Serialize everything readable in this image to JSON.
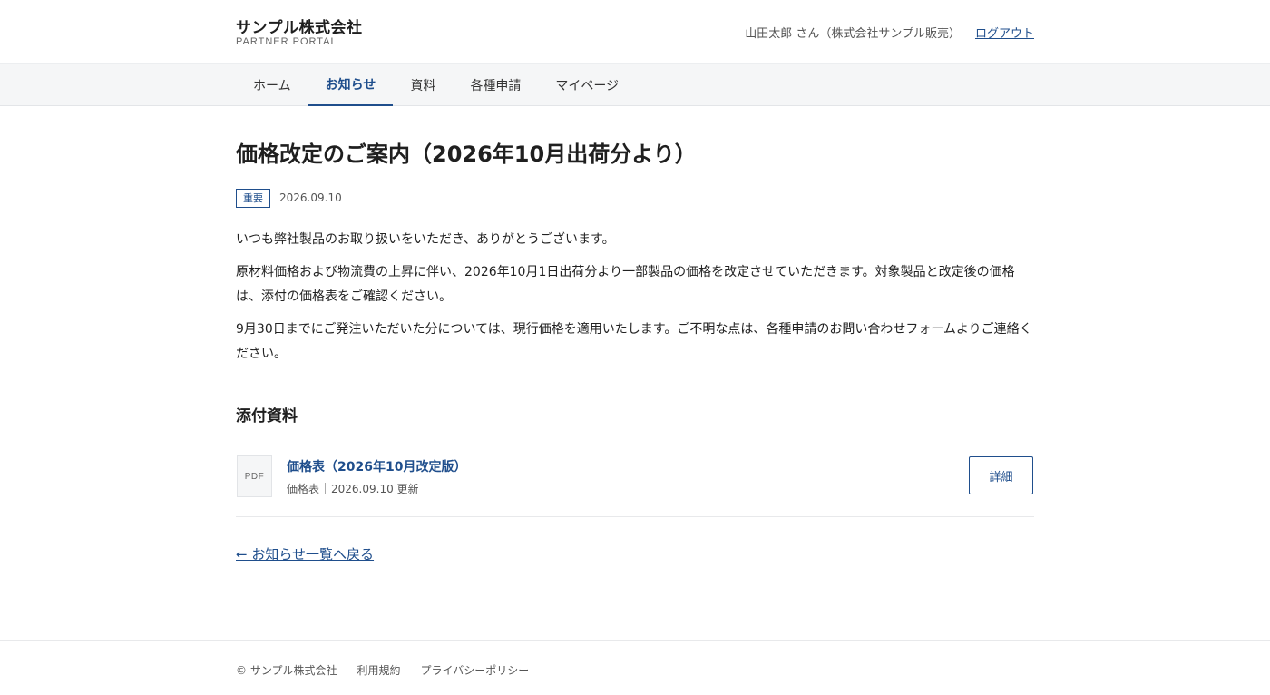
{
  "header": {
    "brand_name": "サンプル株式会社",
    "brand_sub": "PARTNER PORTAL",
    "user_label": "山田太郎 さん（株式会社サンプル販売）",
    "logout_label": "ログアウト"
  },
  "nav": {
    "items": [
      {
        "label": "ホーム",
        "active": false
      },
      {
        "label": "お知らせ",
        "active": true
      },
      {
        "label": "資料",
        "active": false
      },
      {
        "label": "各種申請",
        "active": false
      },
      {
        "label": "マイページ",
        "active": false
      }
    ]
  },
  "article": {
    "title": "価格改定のご案内（2026年10月出荷分より）",
    "badge": "重要",
    "date": "2026.09.10",
    "paragraphs": [
      "いつも弊社製品のお取り扱いをいただき、ありがとうございます。",
      "原材料価格および物流費の上昇に伴い、2026年10月1日出荷分より一部製品の価格を改定させていただきます。対象製品と改定後の価格は、添付の価格表をご確認ください。",
      "9月30日までにご発注いただいた分については、現行価格を適用いたします。ご不明な点は、各種申請のお問い合わせフォームよりご連絡ください。"
    ]
  },
  "attachments": {
    "section_title": "添付資料",
    "items": [
      {
        "icon_label": "PDF",
        "title": "価格表（2026年10月改定版）",
        "category": "価格表",
        "updated": "2026.09.10 更新",
        "button_label": "詳細"
      }
    ]
  },
  "back_link": "← お知らせ一覧へ戻る",
  "footer": {
    "copyright": "© サンプル株式会社",
    "links": [
      "利用規約",
      "プライバシーポリシー"
    ]
  },
  "colors": {
    "accent": "#1f4e8c",
    "nav_bg": "#f5f6f7"
  }
}
